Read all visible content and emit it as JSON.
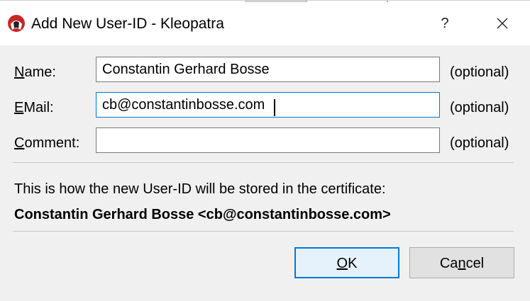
{
  "window": {
    "title": "Add New User-ID - Kleopatra",
    "help_label": "?",
    "app_icon": "kleopatra-icon",
    "accent_color": "#0078d7"
  },
  "form": {
    "name": {
      "mnemonic": "N",
      "label_rest": "ame:",
      "value": "Constantin Gerhard Bosse",
      "optional": "(optional)"
    },
    "email": {
      "mnemonic": "E",
      "label_rest": "Mail:",
      "value": "cb@constantinbosse.com",
      "optional": "(optional)"
    },
    "comment": {
      "mnemonic": "C",
      "label_rest": "omment:",
      "value": "",
      "optional": "(optional)"
    }
  },
  "info": {
    "text": "This is how the new User-ID will be stored in the certificate:",
    "user_id": "Constantin Gerhard Bosse <cb@constantinbosse.com>"
  },
  "buttons": {
    "ok": {
      "mnemonic": "O",
      "rest": "K"
    },
    "cancel": {
      "prefix": "Ca",
      "mnemonic": "n",
      "rest": "cel"
    }
  }
}
